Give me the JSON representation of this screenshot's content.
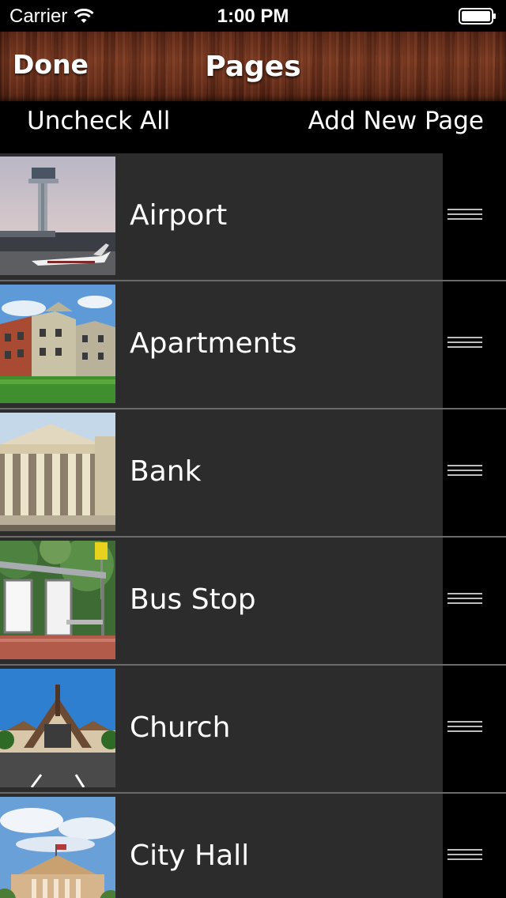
{
  "status_bar": {
    "carrier": "Carrier",
    "time": "1:00 PM",
    "icons": [
      "wifi-icon",
      "battery-icon"
    ]
  },
  "nav_bar": {
    "done_label": "Done",
    "title": "Pages"
  },
  "toolbar": {
    "uncheck_all_label": "Uncheck All",
    "add_new_page_label": "Add New Page"
  },
  "pages": [
    {
      "label": "Airport",
      "thumbnail": "airport-control-tower-photo"
    },
    {
      "label": "Apartments",
      "thumbnail": "apartment-buildings-photo"
    },
    {
      "label": "Bank",
      "thumbnail": "bank-building-columns-photo"
    },
    {
      "label": "Bus Stop",
      "thumbnail": "bus-stop-shelter-photo"
    },
    {
      "label": "Church",
      "thumbnail": "church-building-photo"
    },
    {
      "label": "City Hall",
      "thumbnail": "city-hall-building-photo"
    }
  ],
  "colors": {
    "cell_background": "#2c2c2c",
    "background": "#000000",
    "divider": "#6b6b6b",
    "wood": "#6c311c",
    "text": "#ffffff"
  }
}
